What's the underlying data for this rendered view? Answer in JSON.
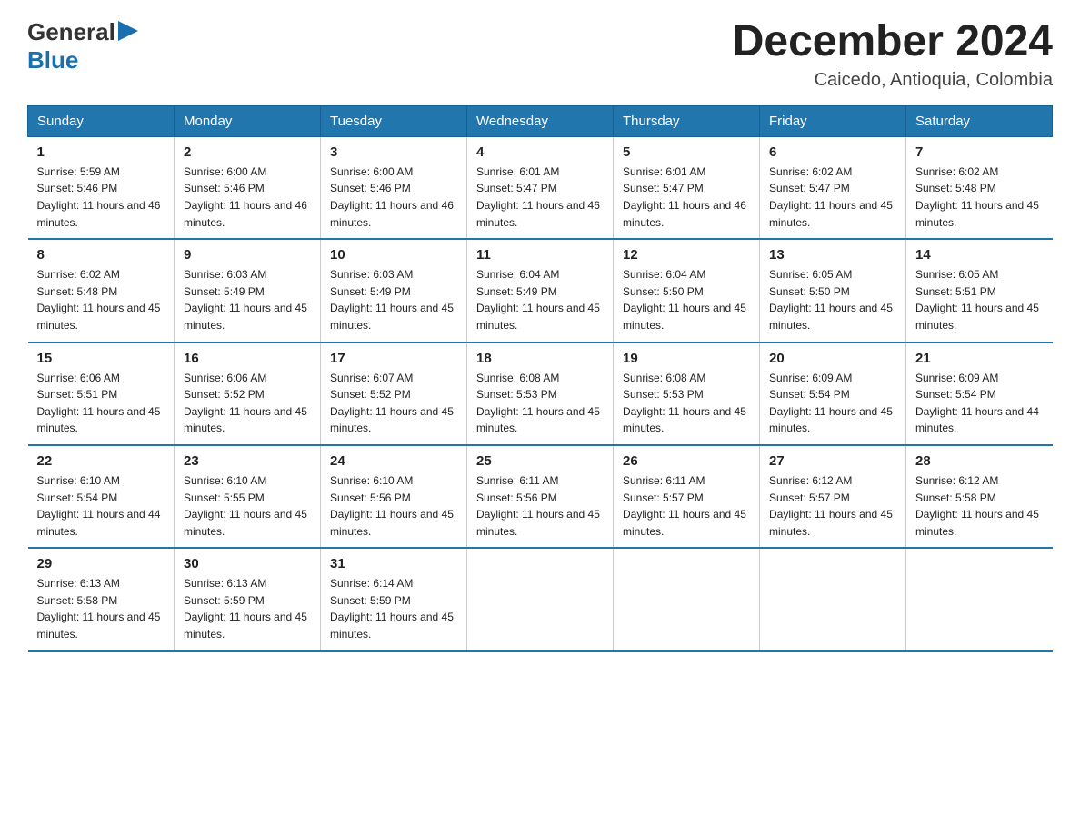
{
  "logo": {
    "general": "General",
    "triangle": "▶",
    "blue": "Blue"
  },
  "header": {
    "month_title": "December 2024",
    "location": "Caicedo, Antioquia, Colombia"
  },
  "days_of_week": [
    "Sunday",
    "Monday",
    "Tuesday",
    "Wednesday",
    "Thursday",
    "Friday",
    "Saturday"
  ],
  "weeks": [
    [
      {
        "day": "1",
        "sunrise": "Sunrise: 5:59 AM",
        "sunset": "Sunset: 5:46 PM",
        "daylight": "Daylight: 11 hours and 46 minutes."
      },
      {
        "day": "2",
        "sunrise": "Sunrise: 6:00 AM",
        "sunset": "Sunset: 5:46 PM",
        "daylight": "Daylight: 11 hours and 46 minutes."
      },
      {
        "day": "3",
        "sunrise": "Sunrise: 6:00 AM",
        "sunset": "Sunset: 5:46 PM",
        "daylight": "Daylight: 11 hours and 46 minutes."
      },
      {
        "day": "4",
        "sunrise": "Sunrise: 6:01 AM",
        "sunset": "Sunset: 5:47 PM",
        "daylight": "Daylight: 11 hours and 46 minutes."
      },
      {
        "day": "5",
        "sunrise": "Sunrise: 6:01 AM",
        "sunset": "Sunset: 5:47 PM",
        "daylight": "Daylight: 11 hours and 46 minutes."
      },
      {
        "day": "6",
        "sunrise": "Sunrise: 6:02 AM",
        "sunset": "Sunset: 5:47 PM",
        "daylight": "Daylight: 11 hours and 45 minutes."
      },
      {
        "day": "7",
        "sunrise": "Sunrise: 6:02 AM",
        "sunset": "Sunset: 5:48 PM",
        "daylight": "Daylight: 11 hours and 45 minutes."
      }
    ],
    [
      {
        "day": "8",
        "sunrise": "Sunrise: 6:02 AM",
        "sunset": "Sunset: 5:48 PM",
        "daylight": "Daylight: 11 hours and 45 minutes."
      },
      {
        "day": "9",
        "sunrise": "Sunrise: 6:03 AM",
        "sunset": "Sunset: 5:49 PM",
        "daylight": "Daylight: 11 hours and 45 minutes."
      },
      {
        "day": "10",
        "sunrise": "Sunrise: 6:03 AM",
        "sunset": "Sunset: 5:49 PM",
        "daylight": "Daylight: 11 hours and 45 minutes."
      },
      {
        "day": "11",
        "sunrise": "Sunrise: 6:04 AM",
        "sunset": "Sunset: 5:49 PM",
        "daylight": "Daylight: 11 hours and 45 minutes."
      },
      {
        "day": "12",
        "sunrise": "Sunrise: 6:04 AM",
        "sunset": "Sunset: 5:50 PM",
        "daylight": "Daylight: 11 hours and 45 minutes."
      },
      {
        "day": "13",
        "sunrise": "Sunrise: 6:05 AM",
        "sunset": "Sunset: 5:50 PM",
        "daylight": "Daylight: 11 hours and 45 minutes."
      },
      {
        "day": "14",
        "sunrise": "Sunrise: 6:05 AM",
        "sunset": "Sunset: 5:51 PM",
        "daylight": "Daylight: 11 hours and 45 minutes."
      }
    ],
    [
      {
        "day": "15",
        "sunrise": "Sunrise: 6:06 AM",
        "sunset": "Sunset: 5:51 PM",
        "daylight": "Daylight: 11 hours and 45 minutes."
      },
      {
        "day": "16",
        "sunrise": "Sunrise: 6:06 AM",
        "sunset": "Sunset: 5:52 PM",
        "daylight": "Daylight: 11 hours and 45 minutes."
      },
      {
        "day": "17",
        "sunrise": "Sunrise: 6:07 AM",
        "sunset": "Sunset: 5:52 PM",
        "daylight": "Daylight: 11 hours and 45 minutes."
      },
      {
        "day": "18",
        "sunrise": "Sunrise: 6:08 AM",
        "sunset": "Sunset: 5:53 PM",
        "daylight": "Daylight: 11 hours and 45 minutes."
      },
      {
        "day": "19",
        "sunrise": "Sunrise: 6:08 AM",
        "sunset": "Sunset: 5:53 PM",
        "daylight": "Daylight: 11 hours and 45 minutes."
      },
      {
        "day": "20",
        "sunrise": "Sunrise: 6:09 AM",
        "sunset": "Sunset: 5:54 PM",
        "daylight": "Daylight: 11 hours and 45 minutes."
      },
      {
        "day": "21",
        "sunrise": "Sunrise: 6:09 AM",
        "sunset": "Sunset: 5:54 PM",
        "daylight": "Daylight: 11 hours and 44 minutes."
      }
    ],
    [
      {
        "day": "22",
        "sunrise": "Sunrise: 6:10 AM",
        "sunset": "Sunset: 5:54 PM",
        "daylight": "Daylight: 11 hours and 44 minutes."
      },
      {
        "day": "23",
        "sunrise": "Sunrise: 6:10 AM",
        "sunset": "Sunset: 5:55 PM",
        "daylight": "Daylight: 11 hours and 45 minutes."
      },
      {
        "day": "24",
        "sunrise": "Sunrise: 6:10 AM",
        "sunset": "Sunset: 5:56 PM",
        "daylight": "Daylight: 11 hours and 45 minutes."
      },
      {
        "day": "25",
        "sunrise": "Sunrise: 6:11 AM",
        "sunset": "Sunset: 5:56 PM",
        "daylight": "Daylight: 11 hours and 45 minutes."
      },
      {
        "day": "26",
        "sunrise": "Sunrise: 6:11 AM",
        "sunset": "Sunset: 5:57 PM",
        "daylight": "Daylight: 11 hours and 45 minutes."
      },
      {
        "day": "27",
        "sunrise": "Sunrise: 6:12 AM",
        "sunset": "Sunset: 5:57 PM",
        "daylight": "Daylight: 11 hours and 45 minutes."
      },
      {
        "day": "28",
        "sunrise": "Sunrise: 6:12 AM",
        "sunset": "Sunset: 5:58 PM",
        "daylight": "Daylight: 11 hours and 45 minutes."
      }
    ],
    [
      {
        "day": "29",
        "sunrise": "Sunrise: 6:13 AM",
        "sunset": "Sunset: 5:58 PM",
        "daylight": "Daylight: 11 hours and 45 minutes."
      },
      {
        "day": "30",
        "sunrise": "Sunrise: 6:13 AM",
        "sunset": "Sunset: 5:59 PM",
        "daylight": "Daylight: 11 hours and 45 minutes."
      },
      {
        "day": "31",
        "sunrise": "Sunrise: 6:14 AM",
        "sunset": "Sunset: 5:59 PM",
        "daylight": "Daylight: 11 hours and 45 minutes."
      },
      null,
      null,
      null,
      null
    ]
  ]
}
